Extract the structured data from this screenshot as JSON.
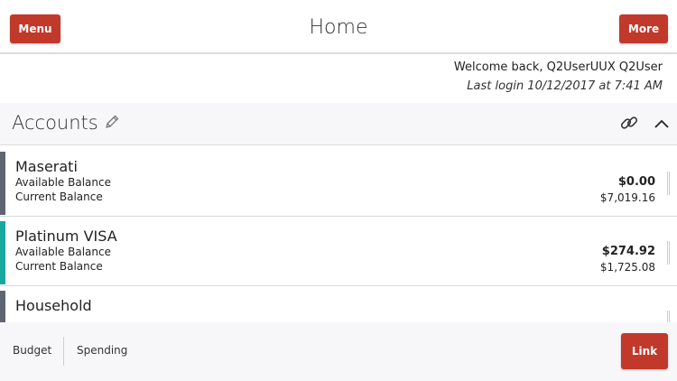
{
  "header": {
    "title": "Home",
    "menu_label": "Menu",
    "more_label": "More"
  },
  "welcome": {
    "greeting": "Welcome back, Q2UserUUX Q2User",
    "last_login": "Last login 10/12/2017 at 7:41 AM"
  },
  "accounts_section": {
    "title": "Accounts",
    "icons": [
      "pencil-icon",
      "link-icon",
      "chevron-up-icon"
    ],
    "items": [
      {
        "name": "Maserati",
        "available_label": "Available Balance",
        "current_label": "Current Balance",
        "available": "$0.00",
        "current": "$7,019.16",
        "color": "#5f6670"
      },
      {
        "name": "Platinum VISA",
        "available_label": "Available Balance",
        "current_label": "Current Balance",
        "available": "$274.92",
        "current": "$1,725.08",
        "color": "#17a8a0"
      },
      {
        "name": "Household",
        "color": "#5f6670"
      }
    ]
  },
  "footer": {
    "tabs": [
      "Budget",
      "Spending"
    ],
    "link_label": "Link"
  },
  "colors": {
    "accent": "#c0392b"
  }
}
